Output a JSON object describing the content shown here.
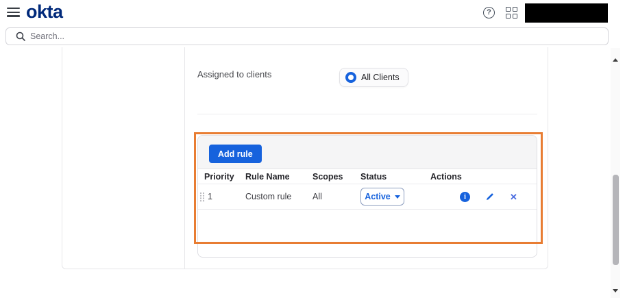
{
  "topbar": {
    "logo_text": "okta",
    "help_label": "?"
  },
  "search": {
    "placeholder": "Search..."
  },
  "content": {
    "assigned_label": "Assigned to clients",
    "all_clients_chip": "All Clients"
  },
  "rules_table": {
    "add_rule_button": "Add rule",
    "columns": [
      "Priority",
      "Rule Name",
      "Scopes",
      "Status",
      "Actions"
    ],
    "rows": [
      {
        "priority": "1",
        "rule_name": "Custom rule",
        "scopes": "All",
        "status": "Active"
      }
    ],
    "info_glyph": "i",
    "x_glyph": "✕"
  },
  "colors": {
    "brand_blue": "#1662dd",
    "logo_navy": "#00297a",
    "highlight_orange": "#e87d33"
  }
}
